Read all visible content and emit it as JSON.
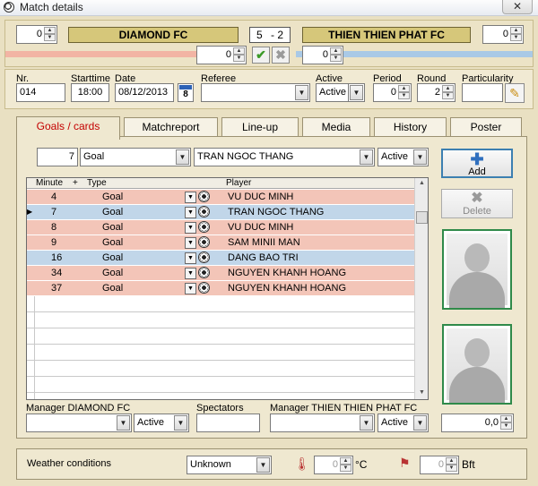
{
  "window": {
    "title": "Match details",
    "close_glyph": "✕"
  },
  "header": {
    "home_team": "DIAMOND FC",
    "away_team": "THIEN THIEN PHAT FC",
    "score_home": "5",
    "score_sep": "-",
    "score_away": "2",
    "home_spin_top": "0",
    "home_spin_bottom": "0",
    "away_spin_top": "0",
    "away_spin_bottom": "0",
    "home_color": "#f2b4a4",
    "away_color": "#a9c9e6",
    "ok_icon": "✔",
    "cancel_icon": "✖"
  },
  "info": {
    "nr_label": "Nr.",
    "nr_value": "014",
    "starttime_label": "Starttime",
    "starttime_value": "18:00",
    "date_label": "Date",
    "date_value": "08/12/2013",
    "calendar_day": "8",
    "referee_label": "Referee",
    "referee_value": "",
    "active_label": "Active",
    "active_value": "Active",
    "period_label": "Period",
    "period_value": "0",
    "round_label": "Round",
    "round_value": "2",
    "particularity_label": "Particularity",
    "particularity_value": ""
  },
  "tabs": [
    {
      "label": "Goals / cards",
      "active": true
    },
    {
      "label": "Matchreport",
      "active": false
    },
    {
      "label": "Line-up",
      "active": false
    },
    {
      "label": "Media",
      "active": false
    },
    {
      "label": "History",
      "active": false
    },
    {
      "label": "Poster",
      "active": false
    }
  ],
  "entry": {
    "minute": "7",
    "type": "Goal",
    "player": "TRAN NGOC THANG",
    "status": "Active"
  },
  "buttons": {
    "add_label": "Add",
    "delete_label": "Delete"
  },
  "table": {
    "headers": {
      "minute": "Minute",
      "sort": "+",
      "type": "Type",
      "player": "Player"
    },
    "rows": [
      {
        "minute": "4",
        "type": "Goal",
        "player": "VU DUC MINH",
        "team": "home",
        "selected": false
      },
      {
        "minute": "7",
        "type": "Goal",
        "player": "TRAN NGOC THANG",
        "team": "away",
        "selected": true
      },
      {
        "minute": "8",
        "type": "Goal",
        "player": "VU DUC MINH",
        "team": "home",
        "selected": false
      },
      {
        "minute": "9",
        "type": "Goal",
        "player": "SAM MINII MAN",
        "team": "home",
        "selected": false
      },
      {
        "minute": "16",
        "type": "Goal",
        "player": "DANG BAO TRI",
        "team": "away",
        "selected": false
      },
      {
        "minute": "34",
        "type": "Goal",
        "player": "NGUYEN KHANH HOANG",
        "team": "home",
        "selected": false
      },
      {
        "minute": "37",
        "type": "Goal",
        "player": "NGUYEN KHANH HOANG",
        "team": "home",
        "selected": false
      }
    ]
  },
  "footer": {
    "manager_home_label": "Manager DIAMOND FC",
    "manager_home_status": "Active",
    "spectators_label": "Spectators",
    "spectators_value": "",
    "manager_away_label": "Manager THIEN THIEN PHAT FC",
    "manager_away_status": "Active",
    "rating_value": "0,0"
  },
  "weather": {
    "label": "Weather conditions",
    "condition": "Unknown",
    "temperature_value": "0",
    "temperature_unit": "°C",
    "wind_value": "0",
    "wind_unit": "Bft"
  }
}
